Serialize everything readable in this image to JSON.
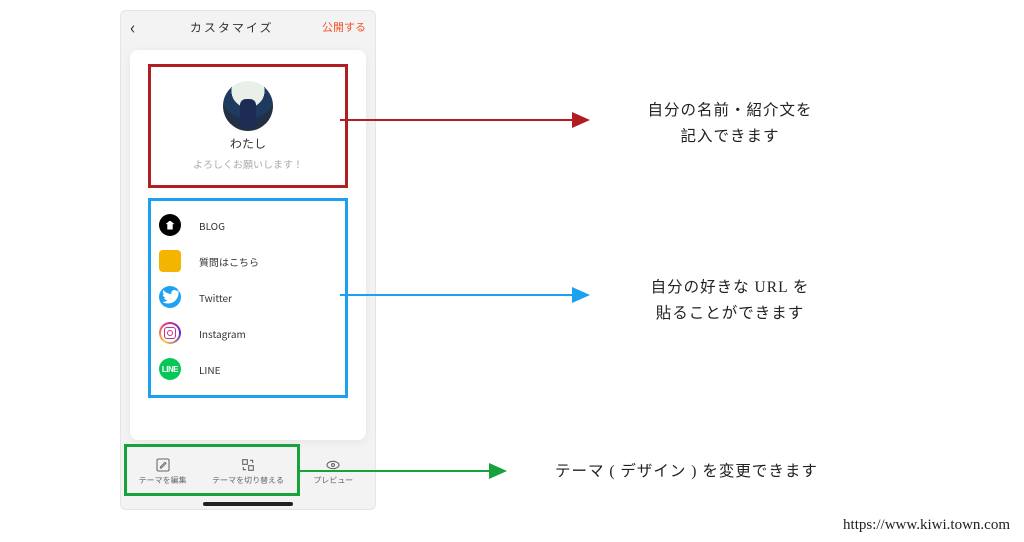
{
  "nav": {
    "title": "カスタマイズ",
    "publish": "公開する"
  },
  "profile": {
    "name": "わたし",
    "bio": "よろしくお願いします！"
  },
  "links": [
    {
      "label": "BLOG"
    },
    {
      "label": "質問はこちら"
    },
    {
      "label": "Twitter"
    },
    {
      "label": "Instagram"
    },
    {
      "label": "LINE"
    }
  ],
  "tabs": {
    "edit": "テーマを編集",
    "switch": "テーマを切り替える",
    "preview": "プレビュー"
  },
  "annotations": {
    "profile_l1": "自分の名前・紹介文を",
    "profile_l2": "記入できます",
    "links_l1": "自分の好きな URL を",
    "links_l2": "貼ることができます",
    "theme": "テーマ ( デザイン ) を変更できます"
  },
  "footer": "https://www.kiwi.town.com"
}
